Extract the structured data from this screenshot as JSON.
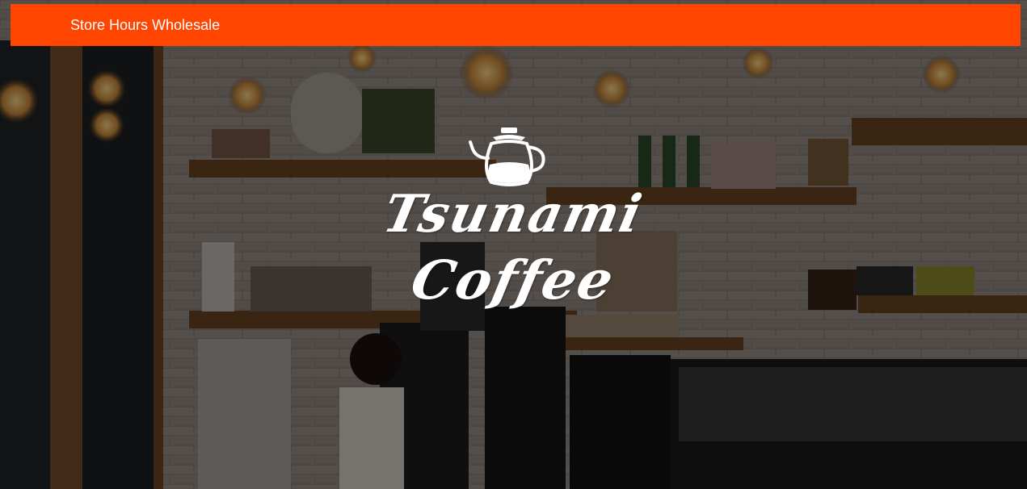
{
  "nav": {
    "background": "#ff4500",
    "links": [
      {
        "label": "Store"
      },
      {
        "label": "Hours"
      },
      {
        "label": "Wholesale"
      }
    ]
  },
  "logo": {
    "line1": "Tsunami",
    "line2": "Coffee",
    "icon": "kettle-icon"
  },
  "hero": {
    "icon": "coffee-shop-interior-photo"
  }
}
